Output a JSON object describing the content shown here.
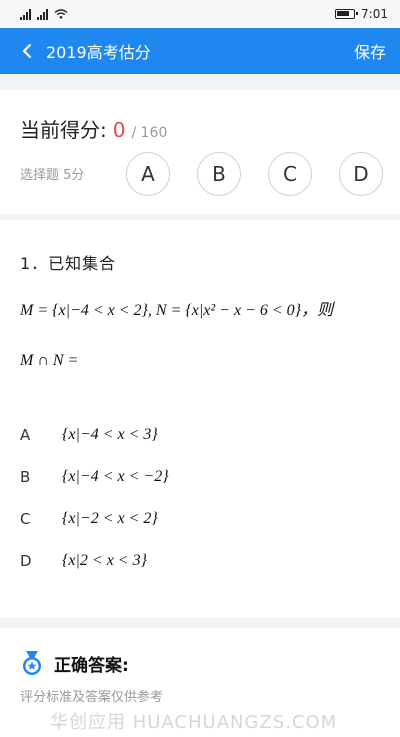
{
  "status_bar": {
    "time": "7:01"
  },
  "app_bar": {
    "title": "2019高考估分",
    "save_label": "保存"
  },
  "score": {
    "label": "当前得分:",
    "value": "0",
    "total": "/ 160"
  },
  "choice": {
    "type_label": "选择题 5分",
    "options": [
      "A",
      "B",
      "C",
      "D"
    ]
  },
  "question": {
    "title": "1．已知集合",
    "line1": "M = {x|−4 < x < 2}, N = {x|x² − x − 6 < 0}，则",
    "line2": "M ∩ N =",
    "options": [
      {
        "letter": "A",
        "text": "{x|−4 < x < 3}"
      },
      {
        "letter": "B",
        "text": "{x|−4 < x < −2}"
      },
      {
        "letter": "C",
        "text": "{x|−2 < x < 2}"
      },
      {
        "letter": "D",
        "text": "{x|2 < x < 3}"
      }
    ]
  },
  "answer": {
    "title": "正确答案:",
    "subtitle": "评分标准及答案仅供参考"
  },
  "watermark": "华创应用   HUACHUANGZS.COM"
}
